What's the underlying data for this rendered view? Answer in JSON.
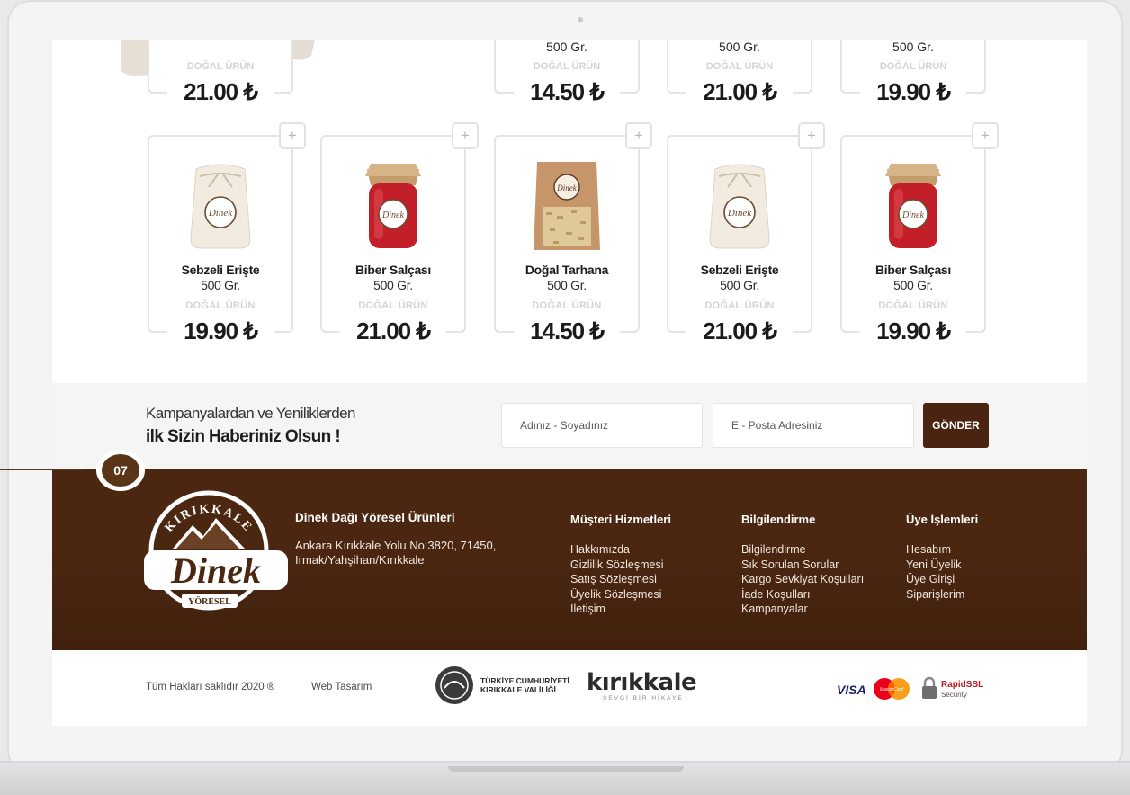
{
  "top_row": [
    {
      "weight": "",
      "label": "DOĞAL ÜRÜN",
      "price": "21.00 ₺"
    },
    {
      "weight": "500 Gr.",
      "label": "DOĞAL ÜRÜN",
      "price": "14.50 ₺"
    },
    {
      "weight": "500 Gr.",
      "label": "DOĞAL ÜRÜN",
      "price": "21.00 ₺"
    },
    {
      "weight": "500 Gr.",
      "label": "DOĞAL ÜRÜN",
      "price": "19.90 ₺"
    }
  ],
  "products": [
    {
      "name": "Sebzeli Erişte",
      "weight": "500 Gr.",
      "label": "DOĞAL ÜRÜN",
      "price": "19.90 ₺",
      "image": "cloth-bag-icon",
      "add": "+"
    },
    {
      "name": "Biber Salçası",
      "weight": "500 Gr.",
      "label": "DOĞAL ÜRÜN",
      "price": "21.00 ₺",
      "image": "jar-icon",
      "add": "+"
    },
    {
      "name": "Doğal Tarhana",
      "weight": "500 Gr.",
      "label": "DOĞAL ÜRÜN",
      "price": "14.50 ₺",
      "image": "kraft-pouch-icon",
      "add": "+"
    },
    {
      "name": "Sebzeli Erişte",
      "weight": "500 Gr.",
      "label": "DOĞAL ÜRÜN",
      "price": "21.00 ₺",
      "image": "cloth-bag-icon",
      "add": "+"
    },
    {
      "name": "Biber Salçası",
      "weight": "500 Gr.",
      "label": "DOĞAL ÜRÜN",
      "price": "19.90 ₺",
      "image": "jar-icon",
      "add": "+"
    }
  ],
  "newsletter": {
    "line1": "Kampanyalardan ve Yeniliklerden",
    "line2": "ilk Sizin Haberiniz Olsun !",
    "name_placeholder": "Adınız - Soyadınız",
    "email_placeholder": "E - Posta Adresiniz",
    "submit": "GÖNDER"
  },
  "marker": "07",
  "footer": {
    "logo": {
      "top": "KIRIKKALE",
      "main": "Dinek",
      "bottom": "YÖRESEL"
    },
    "company": "Dinek Dağı Yöresel Ürünleri",
    "address": "Ankara Kırıkkale Yolu No:3820, 71450, Irmak/Yahşihan/Kırıkkale",
    "columns": [
      {
        "title": "Müşteri Hizmetleri",
        "links": [
          "Hakkımızda",
          "Gizlilik Sözleşmesi",
          "Satış Sözleşmesi",
          "Üyelik Sözleşmesi",
          "İletişim"
        ]
      },
      {
        "title": "Bilgilendirme",
        "links": [
          "Bilgilendirme",
          "Sık Sorulan Sorular",
          "Kargo Sevkiyat Koşulları",
          "İade Koşulları",
          "Kampanyalar"
        ]
      },
      {
        "title": "Üye İşlemleri",
        "links": [
          "Hesabım",
          "Yeni Üyelik",
          "Üye Girişi",
          "Siparişlerim"
        ]
      }
    ]
  },
  "bottom": {
    "copyright": "Tüm Hakları saklıdır 2020 ®",
    "web_design": "Web Tasarım",
    "gov_line1": "TÜRKİYE CUMHURİYETİ",
    "gov_line2": "KIRIKKALE VALİLİĞİ",
    "city_logo": "kırıkkale",
    "city_tagline": "SEVGİ BİR HİKAYE",
    "visa": "VISA",
    "mastercard": "MasterCard",
    "ssl_brand": "RapidSSL",
    "ssl_sub": "Security"
  },
  "colors": {
    "brown": "#4b2711",
    "button": "#4a2410",
    "marker": "#5b3518",
    "visa_blue": "#1a1f71"
  }
}
